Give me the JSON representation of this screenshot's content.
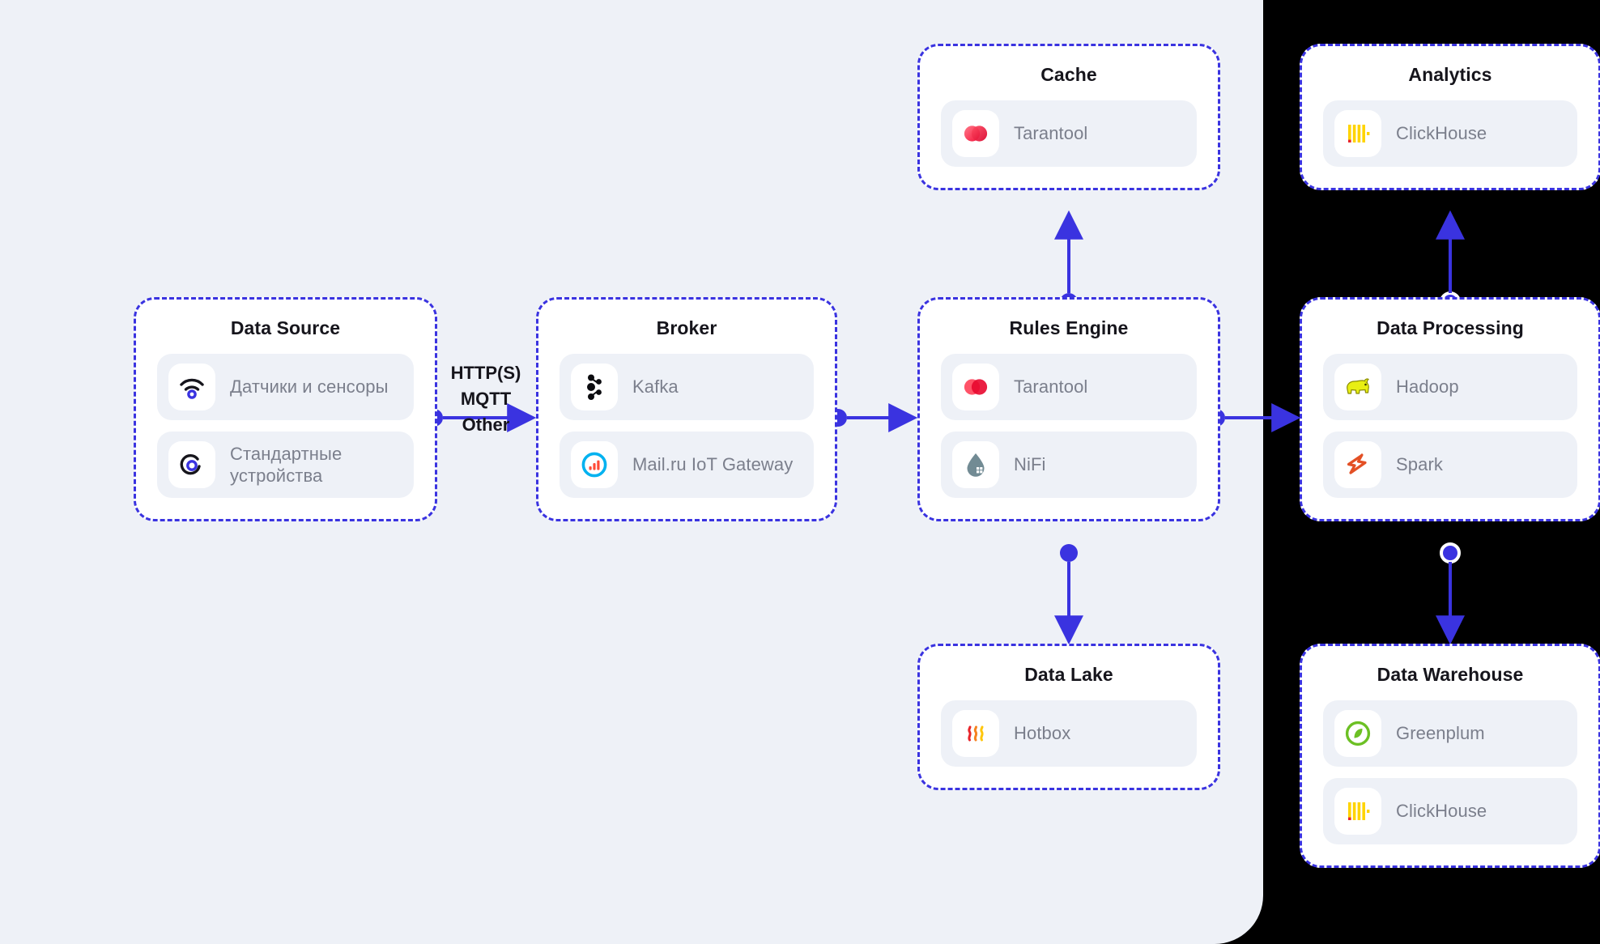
{
  "diagram": {
    "protocol_label": {
      "line1": "HTTP(S)",
      "line2": "MQTT",
      "line3": "Other"
    },
    "accent_color": "#3a33e0",
    "panel_color": "#eef1f7",
    "background_color": "#000000"
  },
  "groups": {
    "data_source": {
      "title": "Data Source",
      "items": [
        {
          "label": "Датчики и сенсоры",
          "icon": "wifi-sensor-icon"
        },
        {
          "label": "Стандартные устройства",
          "icon": "standard-device-icon"
        }
      ]
    },
    "broker": {
      "title": "Broker",
      "items": [
        {
          "label": "Kafka",
          "icon": "kafka-icon"
        },
        {
          "label": "Mail.ru IoT Gateway",
          "icon": "mailru-iot-gateway-icon"
        }
      ]
    },
    "cache": {
      "title": "Cache",
      "items": [
        {
          "label": "Tarantool",
          "icon": "tarantool-icon"
        }
      ]
    },
    "rules_engine": {
      "title": "Rules Engine",
      "items": [
        {
          "label": "Tarantool",
          "icon": "tarantool-icon"
        },
        {
          "label": "NiFi",
          "icon": "nifi-icon"
        }
      ]
    },
    "data_lake": {
      "title": "Data Lake",
      "items": [
        {
          "label": "Hotbox",
          "icon": "hotbox-icon"
        }
      ]
    },
    "analytics": {
      "title": "Analytics",
      "items": [
        {
          "label": "ClickHouse",
          "icon": "clickhouse-icon"
        }
      ]
    },
    "data_processing": {
      "title": "Data Processing",
      "items": [
        {
          "label": "Hadoop",
          "icon": "hadoop-icon"
        },
        {
          "label": "Spark",
          "icon": "spark-icon"
        }
      ]
    },
    "data_warehouse": {
      "title": "Data Warehouse",
      "items": [
        {
          "label": "Greenplum",
          "icon": "greenplum-icon"
        },
        {
          "label": "ClickHouse",
          "icon": "clickhouse-icon"
        }
      ]
    }
  }
}
